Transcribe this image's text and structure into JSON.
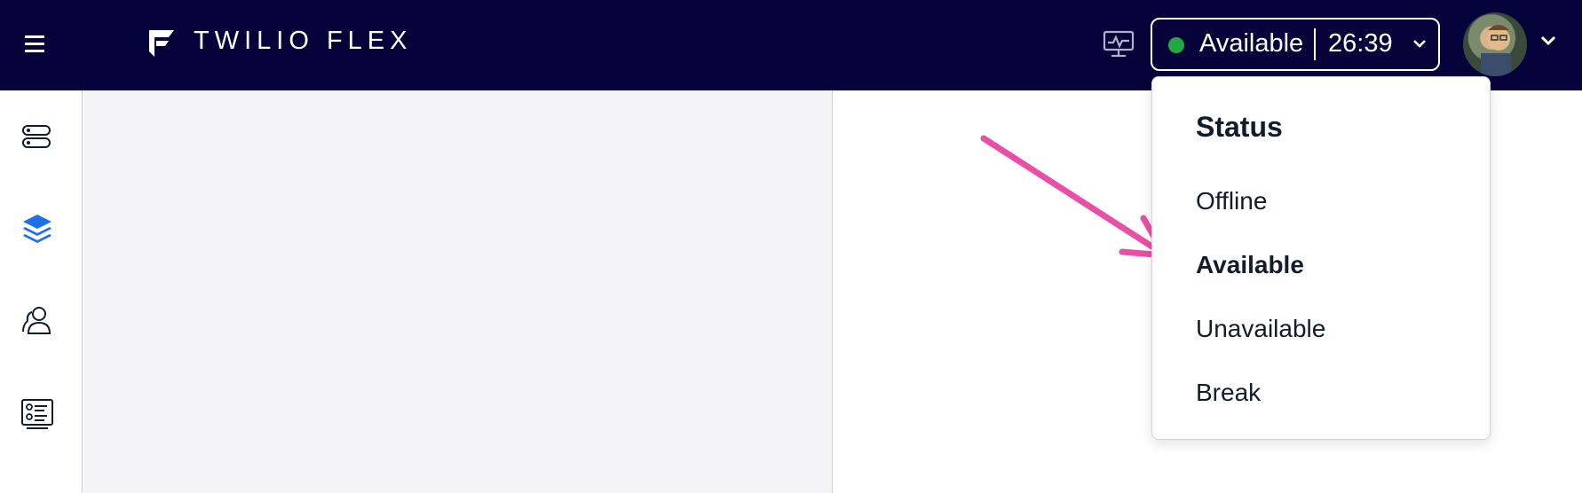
{
  "header": {
    "brand": "TWILIO FLEX",
    "status": {
      "label": "Available",
      "timer": "26:39",
      "color": "#22a744"
    }
  },
  "status_menu": {
    "title": "Status",
    "items": [
      {
        "label": "Offline"
      },
      {
        "label": "Available",
        "selected": true
      },
      {
        "label": "Unavailable"
      },
      {
        "label": "Break"
      }
    ]
  },
  "sidebar": {
    "items": [
      {
        "icon": "agent-desktop-icon",
        "active": false
      },
      {
        "icon": "layers-icon",
        "active": true
      },
      {
        "icon": "teams-icon",
        "active": false
      },
      {
        "icon": "queues-stats-icon",
        "active": false
      }
    ]
  },
  "colors": {
    "topbar": "#06033a",
    "accent": "#1f6feb",
    "annotation_arrow": "#e94fa6"
  }
}
